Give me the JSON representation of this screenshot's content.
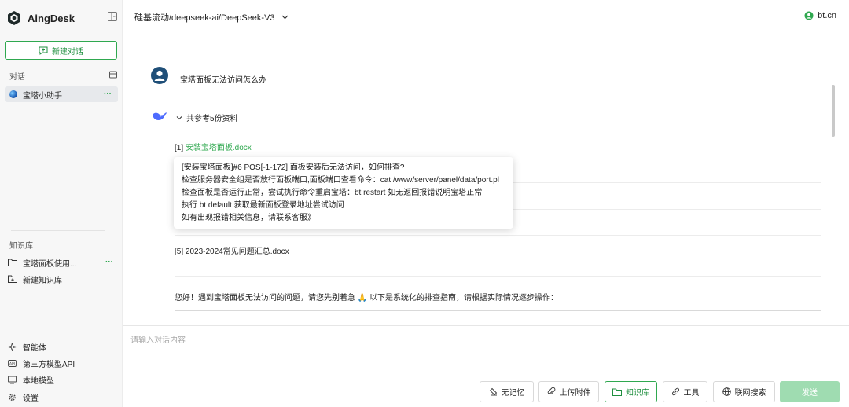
{
  "brand": {
    "name": "AingDesk"
  },
  "sidebar": {
    "new_chat_label": "新建对话",
    "conversations_label": "对话",
    "conversations": [
      {
        "label": "宝塔小助手",
        "more": "···"
      }
    ],
    "knowledge_label": "知识库",
    "knowledge_items": [
      {
        "label": "宝塔面板使用...",
        "more": "···"
      },
      {
        "label": "新建知识库"
      }
    ],
    "nav": [
      {
        "label": "智能体",
        "icon": "agent-icon"
      },
      {
        "label": "第三方模型API",
        "icon": "api-icon"
      },
      {
        "label": "本地模型",
        "icon": "monitor-icon"
      },
      {
        "label": "设置",
        "icon": "gear-icon"
      }
    ]
  },
  "header": {
    "model": "硅基流动/deepseek-ai/DeepSeek-V3",
    "account": "bt.cn"
  },
  "chat": {
    "user_message": "宝塔面板无法访问怎么办",
    "refs_toggle": "共参考5份资料",
    "refs": [
      {
        "index": "[1]",
        "title": "安装宝塔面板.docx"
      },
      {
        "index": "[5]",
        "title": "2023-2024常见问题汇总.docx"
      }
    ],
    "tooltip_lines": [
      "[安装宝塔面板]#6 POS[-1-172] 面板安装后无法访问，如何排查?",
      "检查服务器安全组是否放行面板端口,面板端口查看命令：cat /www/server/panel/data/port.pl",
      "检查面板是否运行正常，尝试执行命令重启宝塔：bt restart 如无返回报错说明宝塔正常",
      "执行 bt default 获取最新面板登录地址尝试访问",
      "如有出现报错相关信息，请联系客服》"
    ],
    "answer": "您好！遇到宝塔面板无法访问的问题，请您先别着急 🙏 以下是系统化的排查指南，请根据实际情况逐步操作："
  },
  "input": {
    "placeholder": "请输入对话内容",
    "buttons": {
      "no_memory": "无记忆",
      "upload": "上传附件",
      "knowledge": "知识库",
      "tools": "工具",
      "web_search": "联网搜索"
    },
    "send": "发送"
  },
  "colors": {
    "accent": "#2fa84f",
    "send_disabled": "#9fdcb1"
  }
}
